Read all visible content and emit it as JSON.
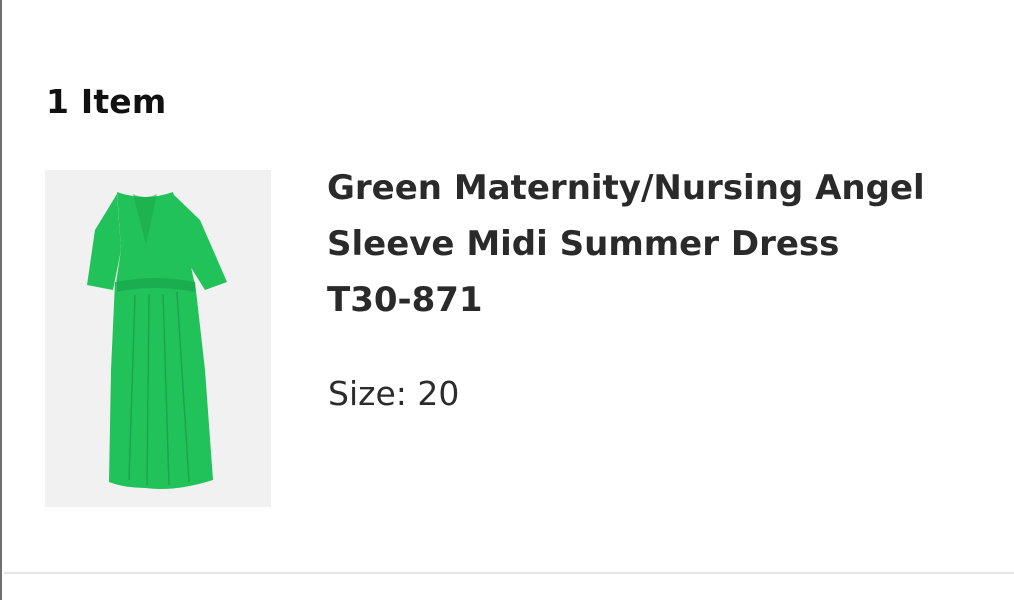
{
  "basket": {
    "item_count": "1 Item"
  },
  "item": {
    "name_line1": "Green Maternity/Nursing Angel",
    "name_line2": "Sleeve Midi Summer Dress",
    "product_code": "T30-871",
    "size_label": "Size: 20",
    "image_icon": "green-dress-thumbnail",
    "dress_color": "#22c25a"
  }
}
